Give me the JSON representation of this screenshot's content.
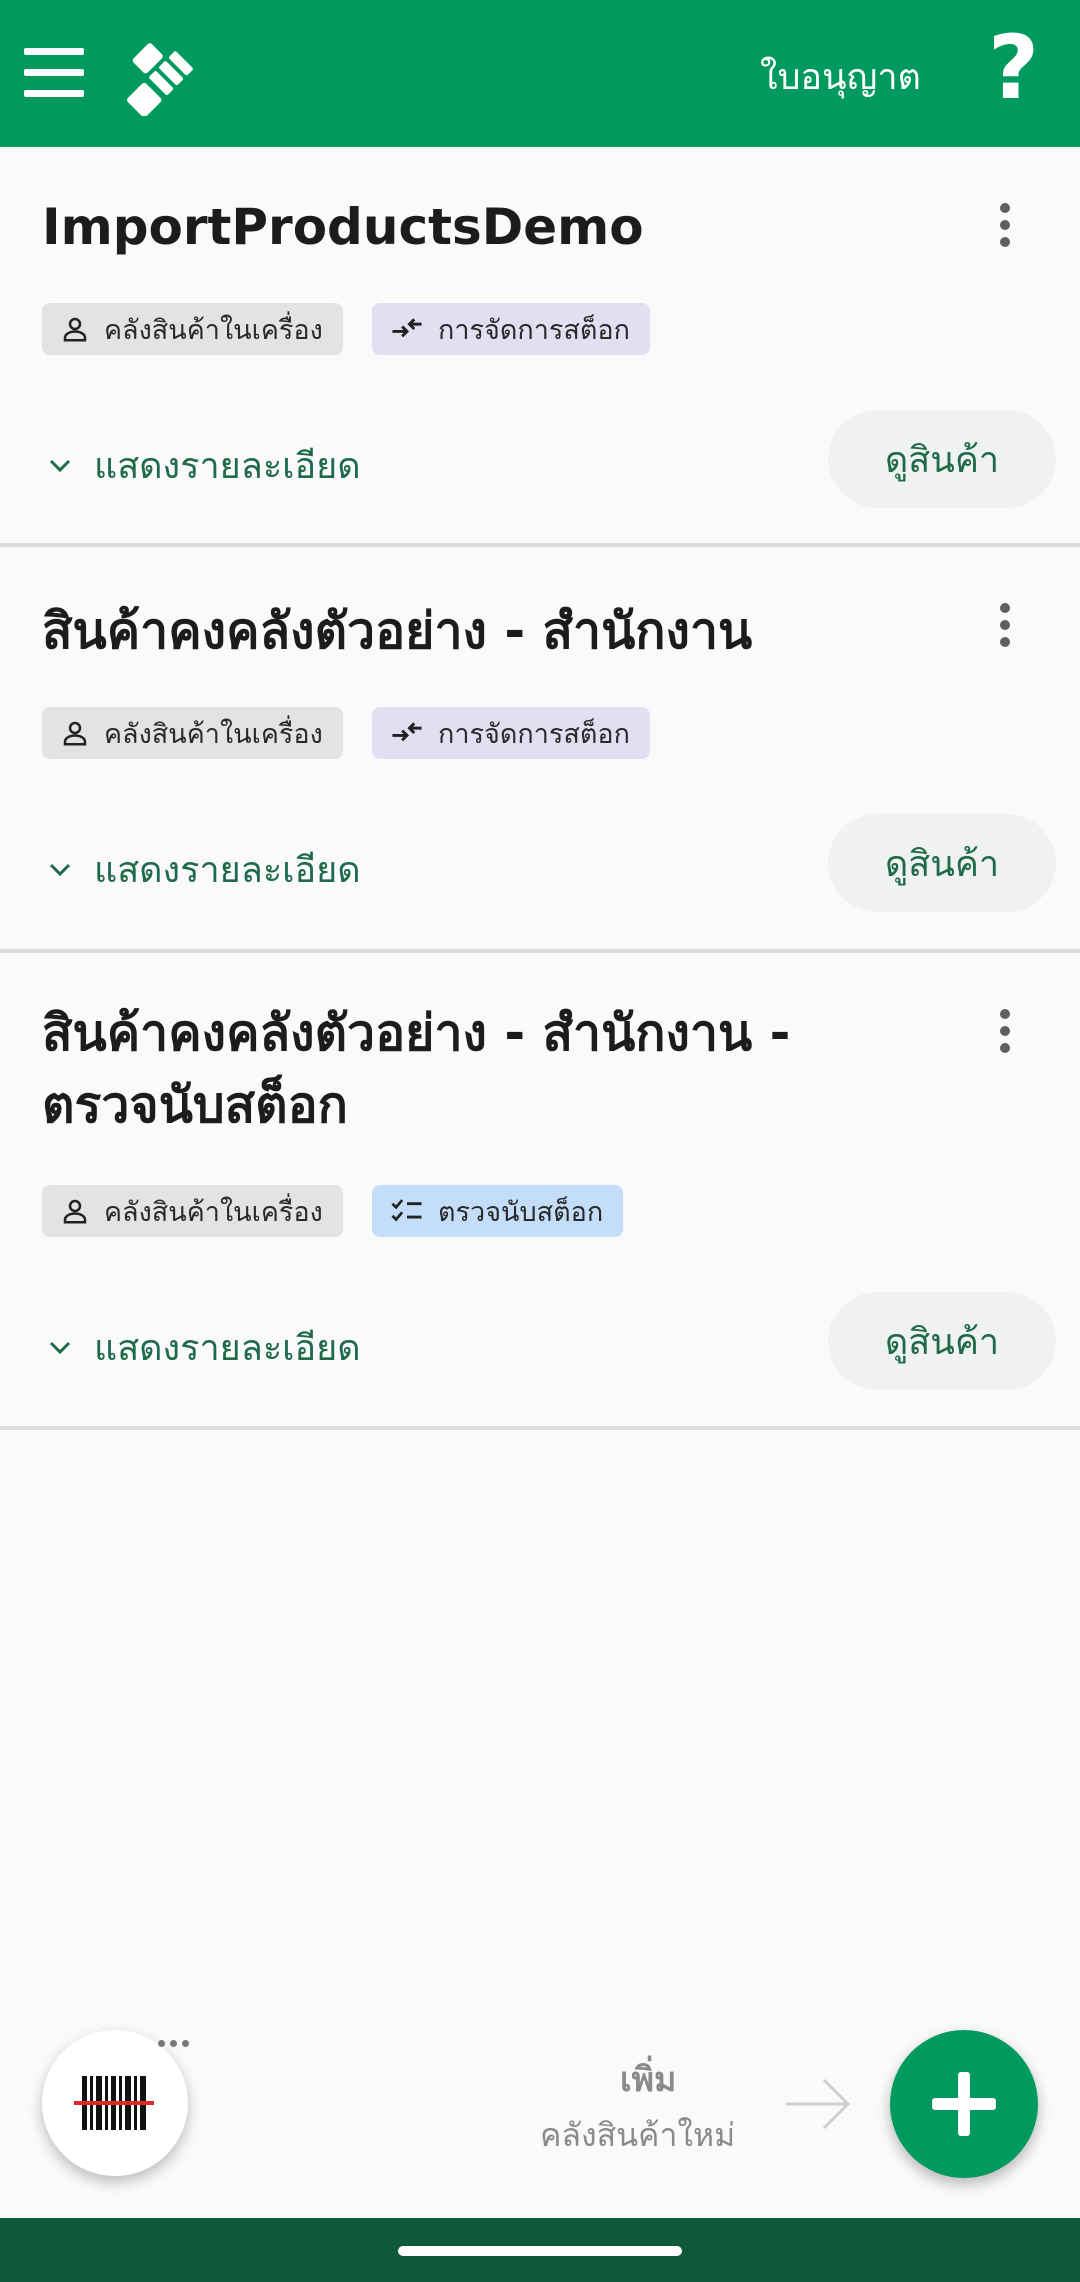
{
  "topbar": {
    "license_label": "ใบอนุญาต",
    "help_label": "?",
    "menu_icon": "hamburger-menu-icon",
    "logo_icon": "app-logo-icon",
    "color": "#009a5e"
  },
  "inventories": [
    {
      "title": "ImportProductsDemo",
      "chips": [
        {
          "icon": "person-icon",
          "label": "คลังสินค้าในเครื่อง"
        },
        {
          "icon": "stock-management-icon",
          "label": "การจัดการสต็อก"
        }
      ],
      "details_label": "แสดงรายละเอียด",
      "view_button": "ดูสินค้า"
    },
    {
      "title": "สินค้าคงคลังตัวอย่าง - สำนักงาน",
      "chips": [
        {
          "icon": "person-icon",
          "label": "คลังสินค้าในเครื่อง"
        },
        {
          "icon": "stock-management-icon",
          "label": "การจัดการสต็อก"
        }
      ],
      "details_label": "แสดงรายละเอียด",
      "view_button": "ดูสินค้า"
    },
    {
      "title": "สินค้าคงคลังตัวอย่าง - สำนักงาน - ตรวจนับสต็อก",
      "chips": [
        {
          "icon": "person-icon",
          "label": "คลังสินค้าในเครื่อง"
        },
        {
          "icon": "stock-count-icon",
          "label": "ตรวจนับสต็อก"
        }
      ],
      "details_label": "แสดงรายละเอียด",
      "view_button": "ดูสินค้า"
    }
  ],
  "bottom": {
    "add_title": "เพิ่ม",
    "add_subtitle": "คลังสินค้าใหม่",
    "scan_icon": "barcode-scan-icon",
    "add_icon": "plus-icon"
  }
}
